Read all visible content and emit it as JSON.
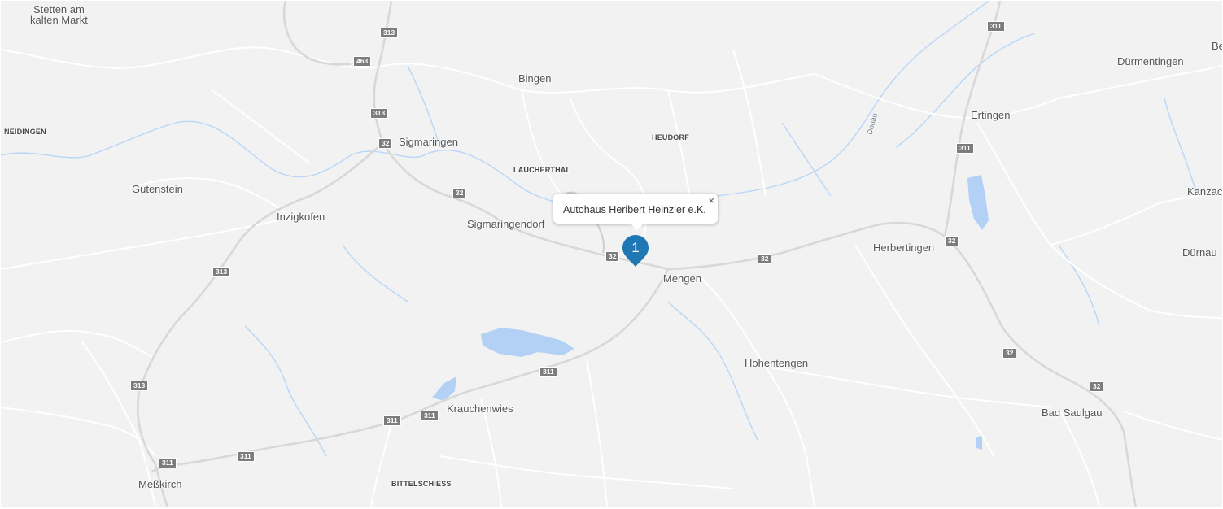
{
  "map": {
    "places": [
      {
        "name": "Stetten am\nkalten Markt",
        "id": "place-stetten"
      },
      {
        "name": "Bingen",
        "id": "place-bingen"
      },
      {
        "name": "NEIDINGEN",
        "id": "place-neidingen"
      },
      {
        "name": "Sigmaringen",
        "id": "place-sigmaringen"
      },
      {
        "name": "HEUDORF",
        "id": "place-heudorf"
      },
      {
        "name": "LAUCHERTHAL",
        "id": "place-laucherthal"
      },
      {
        "name": "Gutenstein",
        "id": "place-gutenstein"
      },
      {
        "name": "Inzigkofen",
        "id": "place-inzigkofen"
      },
      {
        "name": "Sigmaringendorf",
        "id": "place-sigmaringendorf"
      },
      {
        "name": "Mengen",
        "id": "place-mengen"
      },
      {
        "name": "Ertingen",
        "id": "place-ertingen"
      },
      {
        "name": "Dürmentingen",
        "id": "place-duermentingen"
      },
      {
        "name": "Herbertingen",
        "id": "place-herbertingen"
      },
      {
        "name": "Kanzac",
        "id": "place-kanzac"
      },
      {
        "name": "Dürnau",
        "id": "place-duernau"
      },
      {
        "name": "Be",
        "id": "place-be"
      },
      {
        "name": "Hohentengen",
        "id": "place-hohentengen"
      },
      {
        "name": "Krauchenwies",
        "id": "place-krauchenwies"
      },
      {
        "name": "Bad Saulgau",
        "id": "place-bad-saulgau"
      },
      {
        "name": "Meßkirch",
        "id": "place-messkirch"
      },
      {
        "name": "BITTELSCHIESS",
        "id": "place-bittelschiess"
      },
      {
        "name": "Donau",
        "id": "river-donau"
      }
    ],
    "road_shields": [
      "313",
      "463",
      "313",
      "32",
      "32",
      "313",
      "313",
      "311",
      "311",
      "311",
      "311",
      "311",
      "32",
      "32",
      "32",
      "32",
      "32",
      "311",
      "311"
    ],
    "colors": {
      "land": "#f2f2f2",
      "road": "#ffffff",
      "highway": "#d9d9d9",
      "water": "#aacbf5",
      "marker": "#1f78b4"
    }
  },
  "marker": {
    "number": "1"
  },
  "infowindow": {
    "title": "Autohaus Heribert Heinzler e.K.",
    "close_label": "×"
  }
}
